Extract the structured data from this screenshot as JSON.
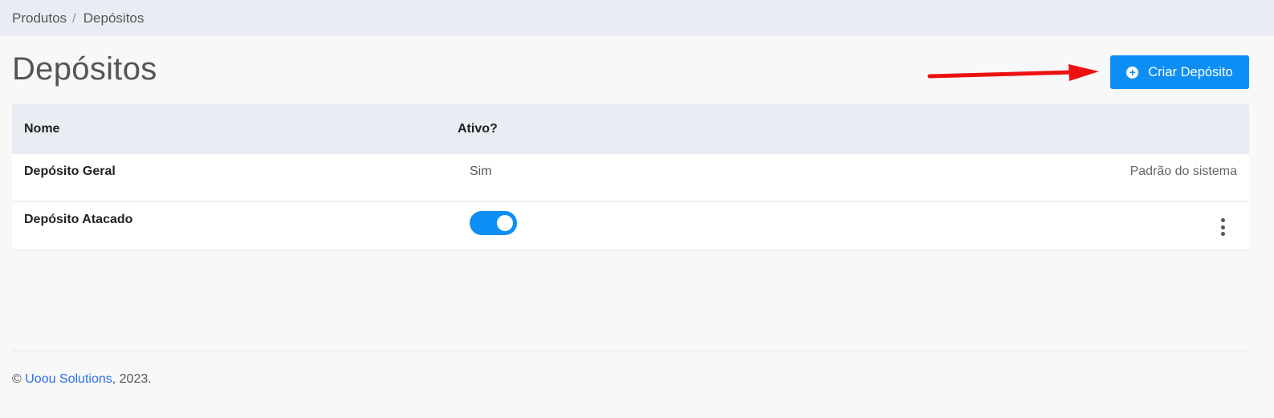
{
  "breadcrumb": {
    "items": [
      "Produtos",
      "Depósitos"
    ],
    "separator": "/"
  },
  "page": {
    "title": "Depósitos"
  },
  "toolbar": {
    "create_label": "Criar Depósito",
    "create_icon": "plus-circle-icon"
  },
  "table": {
    "headers": {
      "name": "Nome",
      "active": "Ativo?"
    },
    "rows": [
      {
        "name": "Depósito Geral",
        "active_text": "Sim",
        "note": "Padrão do sistema"
      },
      {
        "name": "Depósito Atacado",
        "active": true,
        "actions_icon": "kebab-menu-icon"
      }
    ]
  },
  "footer": {
    "prefix": "© ",
    "company": "Uoou Solutions",
    "suffix": ", 2023."
  },
  "colors": {
    "primary": "#0d8ef5",
    "annotation_arrow": "#ee1111",
    "header_bg": "#e9ecf3"
  }
}
